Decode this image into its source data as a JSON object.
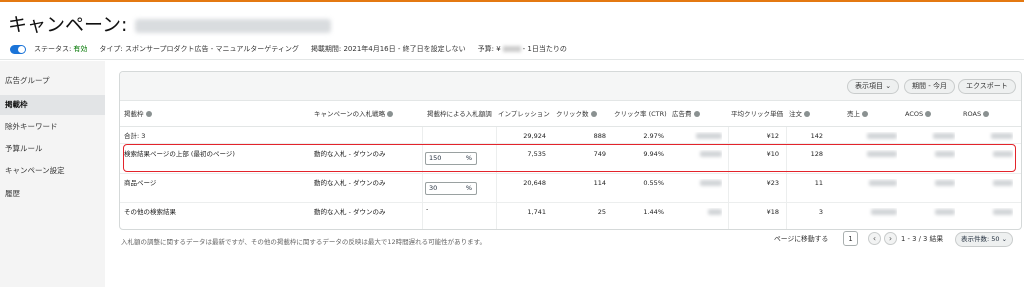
{
  "header": {
    "title": "キャンペーン:",
    "status_label": "ステータス:",
    "status_value": "有効",
    "type": "タイプ: スポンサープロダクト広告 - マニュアルターゲティング",
    "period": "掲載期間: 2021年4月16日 - 終了日を設定しない",
    "budget_prefix": "予算: ¥",
    "budget_suffix": "- 1日当たりの"
  },
  "sidebar": {
    "items": [
      {
        "label": "広告グループ"
      },
      {
        "label": "掲載枠"
      },
      {
        "label": "除外キーワード"
      },
      {
        "label": "予算ルール"
      },
      {
        "label": "キャンペーン設定"
      },
      {
        "label": "履歴"
      }
    ]
  },
  "toolbar": {
    "columns_button": "表示項目",
    "date_button": "期間 - 今月",
    "export_button": "エクスポート"
  },
  "table": {
    "headers": {
      "placement": "掲載枠",
      "strategy": "キャンペーンの入札戦略",
      "adjust": "掲載枠による入札額調",
      "impressions": "インプレッション",
      "clicks": "クリック数",
      "ctr": "クリック率 (CTR)",
      "spend": "広告費",
      "cpc": "平均クリック単価",
      "orders": "注文",
      "sales": "売上",
      "acos": "ACOS",
      "roas": "ROAS"
    },
    "total": {
      "label": "合計: 3",
      "impressions": "29,924",
      "clicks": "888",
      "ctr": "2.97%",
      "cpc": "¥12",
      "orders": "142"
    },
    "rows": [
      {
        "placement": "検索結果ページの上部 (最初のページ)",
        "strategy": "動的な入札 - ダウンのみ",
        "adjust": "150",
        "pct": "%",
        "impressions": "7,535",
        "clicks": "749",
        "ctr": "9.94%",
        "cpc": "¥10",
        "orders": "128"
      },
      {
        "placement": "商品ページ",
        "strategy": "動的な入札 - ダウンのみ",
        "adjust": "30",
        "pct": "%",
        "impressions": "20,648",
        "clicks": "114",
        "ctr": "0.55%",
        "cpc": "¥23",
        "orders": "11"
      },
      {
        "placement": "その他の検索結果",
        "strategy": "動的な入札 - ダウンのみ",
        "adjust": "-",
        "impressions": "1,741",
        "clicks": "25",
        "ctr": "1.44%",
        "cpc": "¥18",
        "orders": "3"
      }
    ]
  },
  "footer": {
    "note": "入札額の調整に関するデータは最新ですが、その他の掲載枠に関するデータの反映は最大で12時間遅れる可能性があります。",
    "goto_label": "ページに移動する",
    "page_value": "1",
    "prev_icon": "‹",
    "next_icon": "›",
    "range": "1 - 3 / 3 結果",
    "per_page": "表示件数: 50"
  },
  "colors": {
    "accent": "#e47911",
    "toggle": "#1b74d8",
    "status": "#007600",
    "highlight": "#e3242b"
  }
}
